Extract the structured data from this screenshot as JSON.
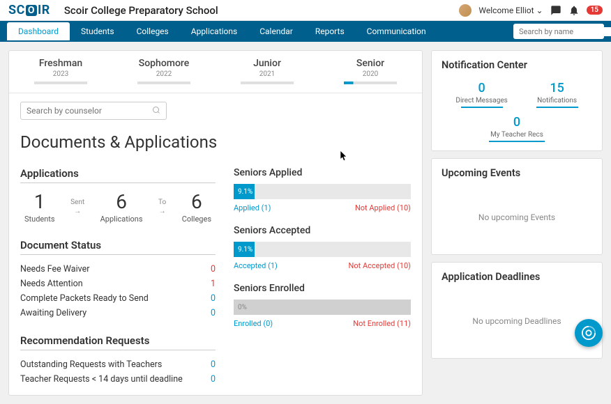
{
  "brand": {
    "pre": "SC",
    "mid": "O",
    "post": "IR"
  },
  "header": {
    "school": "Scoir College Preparatory School",
    "welcome": "Welcome Elliot",
    "badge": "15"
  },
  "nav": {
    "tabs": [
      "Dashboard",
      "Students",
      "Colleges",
      "Applications",
      "Calendar",
      "Reports",
      "Communication"
    ],
    "search_placeholder": "Search by name"
  },
  "class_tabs": [
    {
      "name": "Freshman",
      "year": "2023"
    },
    {
      "name": "Sophomore",
      "year": "2022"
    },
    {
      "name": "Junior",
      "year": "2021"
    },
    {
      "name": "Senior",
      "year": "2020"
    }
  ],
  "counselor_search_placeholder": "Search by counselor",
  "page_title": "Documents & Applications",
  "applications": {
    "title": "Applications",
    "students": {
      "num": "1",
      "label": "Students"
    },
    "sent": "Sent",
    "apps": {
      "num": "6",
      "label": "Applications"
    },
    "to": "To",
    "colleges": {
      "num": "6",
      "label": "Colleges"
    }
  },
  "doc_status": {
    "title": "Document Status",
    "rows": [
      {
        "label": "Needs Fee Waiver",
        "count": "0",
        "color": "red"
      },
      {
        "label": "Needs Attention",
        "count": "1",
        "color": "red"
      },
      {
        "label": "Complete Packets Ready to Send",
        "count": "0",
        "color": "blue"
      },
      {
        "label": "Awaiting Delivery",
        "count": "0",
        "color": "blue"
      }
    ]
  },
  "rec_requests": {
    "title": "Recommendation Requests",
    "rows": [
      {
        "label": "Outstanding Requests with Teachers",
        "count": "0"
      },
      {
        "label": "Teacher Requests < 14 days until deadline",
        "count": "0"
      }
    ]
  },
  "progress": [
    {
      "title": "Seniors Applied",
      "pct": "9.1%",
      "width": "9.1%",
      "left": "Applied (1)",
      "right": "Not Applied (10)"
    },
    {
      "title": "Seniors Accepted",
      "pct": "9.1%",
      "width": "9.1%",
      "left": "Accepted (1)",
      "right": "Not Accepted (10)"
    },
    {
      "title": "Seniors Enrolled",
      "pct": "0%",
      "width": "0%",
      "left": "Enrolled (0)",
      "right": "Not Enrolled (11)"
    }
  ],
  "notif_center": {
    "title": "Notification Center",
    "dm": {
      "num": "0",
      "label": "Direct Messages"
    },
    "notif": {
      "num": "15",
      "label": "Notifications"
    },
    "teacher": {
      "num": "0",
      "label": "My Teacher Recs"
    }
  },
  "upcoming_events": {
    "title": "Upcoming Events",
    "empty": "No upcoming Events"
  },
  "deadlines": {
    "title": "Application Deadlines",
    "empty": "No upcoming Deadlines"
  }
}
